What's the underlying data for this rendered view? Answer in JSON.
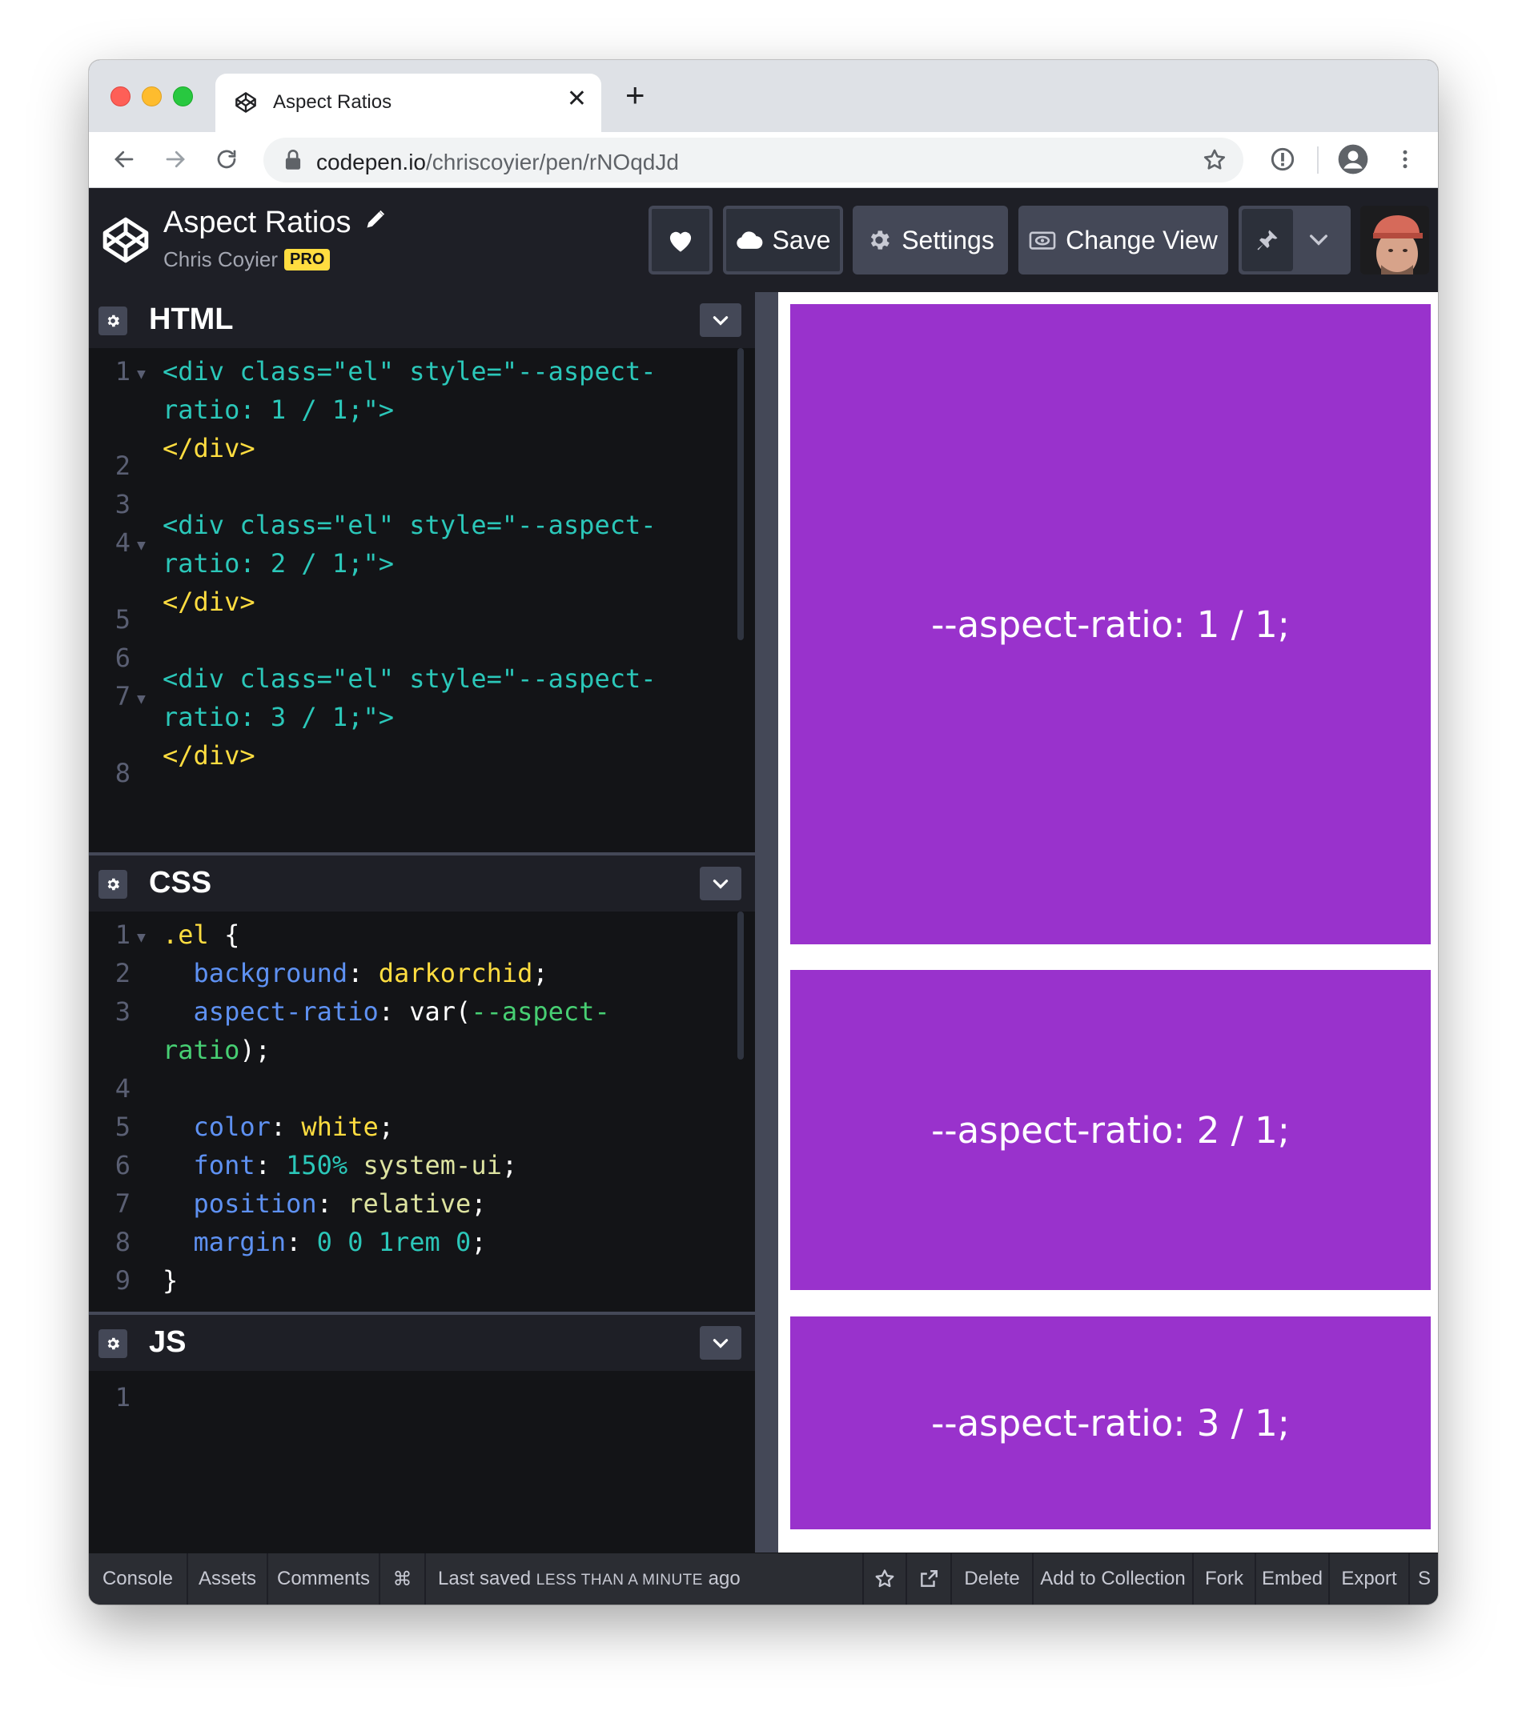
{
  "browser": {
    "tab_title": "Aspect Ratios",
    "url_host": "codepen.io",
    "url_path": "/chriscoyier/pen/rNOqdJd"
  },
  "header": {
    "pen_title": "Aspect Ratios",
    "author": "Chris Coyier",
    "badge": "PRO",
    "save_label": "Save",
    "settings_label": "Settings",
    "change_view_label": "Change View"
  },
  "editors": {
    "html_label": "HTML",
    "css_label": "CSS",
    "js_label": "JS"
  },
  "html_code": {
    "line_numbers": [
      "1",
      "",
      "2",
      "3",
      "4",
      "",
      "5",
      "6",
      "7",
      "",
      "8"
    ],
    "l1a": "<div class=\"el\" style=\"--aspect-",
    "l1b": "ratio: 1 / 1;\">",
    "l2": "</div>",
    "l4a": "<div class=\"el\" style=\"--aspect-",
    "l4b": "ratio: 2 / 1;\">",
    "l5": "</div>",
    "l7a": "<div class=\"el\" style=\"--aspect-",
    "l7b": "ratio: 3 / 1;\">",
    "l8": "</div>"
  },
  "css_code": {
    "line_numbers": [
      "1",
      "2",
      "3",
      "",
      "4",
      "5",
      "6",
      "7",
      "8",
      "9"
    ],
    "selector": ".el",
    "open_brace": "{",
    "close_brace": "}",
    "p_background": "background",
    "v_background": "darkorchid",
    "p_aspect": "aspect-ratio",
    "v_aspect_fn": "var(",
    "v_aspect_var_a": "--aspect-",
    "v_aspect_var_b": "ratio",
    "v_aspect_close": ");",
    "p_color": "color",
    "v_color": "white",
    "p_font": "font",
    "v_font_num": "150%",
    "v_font_kw": "system-ui",
    "p_position": "position",
    "v_position": "relative",
    "p_margin": "margin",
    "v_margin": "0 0 1rem 0"
  },
  "js_code": {
    "line_numbers": [
      "1"
    ]
  },
  "preview": {
    "box1": "--aspect-ratio: 1 / 1;",
    "box2": "--aspect-ratio: 2 / 1;",
    "box3": "--aspect-ratio: 3 / 1;",
    "box_color": "#9932cc"
  },
  "footer": {
    "console": "Console",
    "assets": "Assets",
    "comments": "Comments",
    "shortcut": "⌘",
    "saved_prefix": "Last saved",
    "saved_time": "LESS THAN A MINUTE",
    "saved_suffix": "ago",
    "delete": "Delete",
    "add_to_collection": "Add to Collection",
    "fork": "Fork",
    "embed": "Embed",
    "export": "Export",
    "share_partial": "S"
  }
}
